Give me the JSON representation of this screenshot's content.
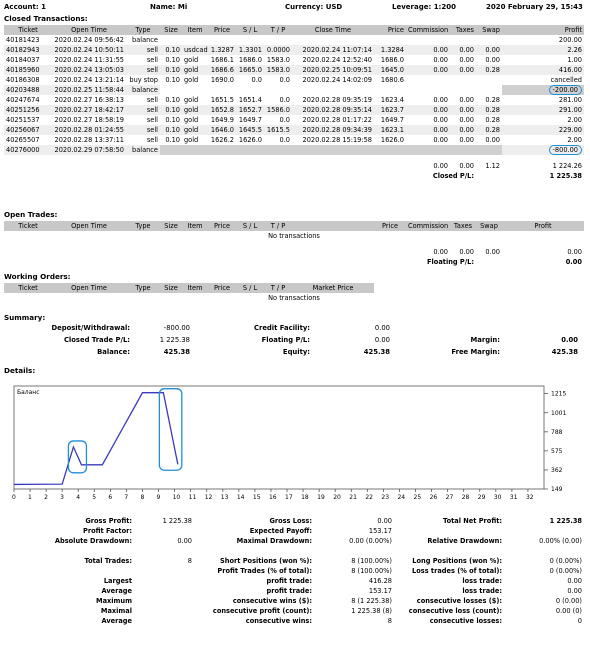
{
  "header": {
    "account": "Account: 1",
    "name": "Name: Mi",
    "currency": "Currency: USD",
    "leverage": "Leverage: 1:200",
    "date": "2020 February 29, 15:43"
  },
  "closed": {
    "title": "Closed Transactions:",
    "columns": [
      "Ticket",
      "Open Time",
      "Type",
      "Size",
      "Item",
      "Price",
      "S / L",
      "T / P",
      "Close Time",
      "Price",
      "Commission",
      "Taxes",
      "Swap",
      "Profit"
    ],
    "rows": [
      [
        "40181423",
        "2020.02.24 09:56:42",
        "balance",
        "",
        "",
        "",
        "",
        "",
        "",
        "",
        "",
        "",
        "",
        "200.00"
      ],
      [
        "40182943",
        "2020.02.24 10:50:11",
        "sell",
        "0.10",
        "usdcad",
        "1.3287",
        "1.3301",
        "0.0000",
        "2020.02.24 11:07:14",
        "1.3284",
        "0.00",
        "0.00",
        "0.00",
        "2.26"
      ],
      [
        "40184037",
        "2020.02.24 11:31:55",
        "sell",
        "0.10",
        "gold",
        "1686.1",
        "1686.0",
        "1583.0",
        "2020.02.24 12:52:40",
        "1686.0",
        "0.00",
        "0.00",
        "0.00",
        "1.00"
      ],
      [
        "40185960",
        "2020.02.24 13:05:03",
        "sell",
        "0.10",
        "gold",
        "1686.6",
        "1665.0",
        "1583.0",
        "2020.02.25 10:09:51",
        "1645.0",
        "0.00",
        "0.00",
        "0.28",
        "416.00"
      ],
      [
        "40186308",
        "2020.02.24 13:21:14",
        "buy stop",
        "0.10",
        "gold",
        "1690.0",
        "0.0",
        "0.0",
        "2020.02.24 14:02:09",
        "1680.6",
        "",
        "",
        "",
        "cancelled"
      ],
      [
        "40203488",
        "2020.02.25 11:58:44",
        "balance",
        "",
        "",
        "",
        "",
        "",
        "",
        "",
        "",
        "",
        "",
        "-200.00"
      ],
      [
        "40247674",
        "2020.02.27 16:38:13",
        "sell",
        "0.10",
        "gold",
        "1651.5",
        "1651.4",
        "0.0",
        "2020.02.28 09:35:19",
        "1623.4",
        "0.00",
        "0.00",
        "0.28",
        "281.00"
      ],
      [
        "40251256",
        "2020.02.27 18:42:17",
        "sell",
        "0.10",
        "gold",
        "1652.8",
        "1652.7",
        "1586.0",
        "2020.02.28 09:35:14",
        "1623.7",
        "0.00",
        "0.00",
        "0.28",
        "291.00"
      ],
      [
        "40251537",
        "2020.02.27 18:58:19",
        "sell",
        "0.10",
        "gold",
        "1649.9",
        "1649.7",
        "0.0",
        "2020.02.28 01:17:22",
        "1649.7",
        "0.00",
        "0.00",
        "0.28",
        "2.00"
      ],
      [
        "40256067",
        "2020.02.28 01:24:55",
        "sell",
        "0.10",
        "gold",
        "1646.0",
        "1645.5",
        "1615.5",
        "2020.02.28 09:34:39",
        "1623.1",
        "0.00",
        "0.00",
        "0.28",
        "229.00"
      ],
      [
        "40265507",
        "2020.02.28 13:37:11",
        "sell",
        "0.10",
        "gold",
        "1626.2",
        "1626.0",
        "0.0",
        "2020.02.28 15:19:58",
        "1626.0",
        "0.00",
        "0.00",
        "0.00",
        "2.00"
      ],
      [
        "40276000",
        "2020.02.29 07:58:50",
        "balance",
        "",
        "",
        "",
        "",
        "",
        "",
        "",
        "",
        "",
        "",
        "-800.00"
      ]
    ],
    "totals": {
      "commission": "0.00",
      "taxes": "0.00",
      "swap": "1.12",
      "profit": "1 224.26"
    },
    "pl_label": "Closed P/L:",
    "pl_value": "1 225.38"
  },
  "open": {
    "title": "Open Trades:",
    "columns": [
      "Ticket",
      "Open Time",
      "Type",
      "Size",
      "Item",
      "Price",
      "S / L",
      "T / P",
      "",
      "Price",
      "Commission",
      "Taxes",
      "Swap",
      "Profit"
    ],
    "empty": "No transactions",
    "totals": {
      "commission": "0.00",
      "taxes": "0.00",
      "swap": "0.00",
      "profit": "0.00"
    },
    "pl_label": "Floating P/L:",
    "pl_value": "0.00"
  },
  "working": {
    "title": "Working Orders:",
    "columns": [
      "Ticket",
      "Open Time",
      "Type",
      "Size",
      "Item",
      "Price",
      "S / L",
      "T / P",
      "Market Price"
    ],
    "empty": "No transactions"
  },
  "summary": {
    "title": "Summary:",
    "deposit_label": "Deposit/Withdrawal:",
    "deposit": "-800.00",
    "credit_label": "Credit Facility:",
    "credit": "0.00",
    "closed_label": "Closed Trade P/L:",
    "closed": "1 225.38",
    "floating_label": "Floating P/L:",
    "floating": "0.00",
    "margin_label": "Margin:",
    "margin": "0.00",
    "balance_label": "Balance:",
    "balance": "425.38",
    "equity_label": "Equity:",
    "equity": "425.38",
    "free_label": "Free Margin:",
    "free": "425.38"
  },
  "details_title": "Details:",
  "chart_data": {
    "type": "line",
    "series": [
      {
        "name": "Баланс",
        "values": [
          [
            0,
            200
          ],
          [
            1.5,
            202.26
          ],
          [
            3,
            203.26
          ],
          [
            3.7,
            619.26
          ],
          [
            4.2,
            419.26
          ],
          [
            5.5,
            419.26
          ],
          [
            8,
            1225.38
          ],
          [
            9.3,
            1225.38
          ],
          [
            10.2,
            425.38
          ]
        ]
      }
    ],
    "xlim": [
      0,
      33
    ],
    "ylim": [
      149,
      1300
    ],
    "yticks": [
      "1215",
      "1001",
      "788",
      "575",
      "362",
      "149"
    ],
    "ytick_values": [
      1215,
      1001,
      788,
      575,
      362,
      149
    ],
    "xticks": [
      "0",
      "1",
      "2",
      "3",
      "4",
      "5",
      "6",
      "7",
      "8",
      "9",
      "10",
      "11",
      "12",
      "13",
      "14",
      "15",
      "16",
      "17",
      "18",
      "19",
      "20",
      "21",
      "22",
      "23",
      "24",
      "25",
      "26",
      "27",
      "28",
      "29",
      "30",
      "31",
      "32"
    ],
    "legend": "Баланс",
    "line_color": "#3a3abf",
    "highlight_color": "#1f8fd6"
  },
  "stats": [
    [
      "Gross Profit:",
      "1 225.38",
      "Gross Loss:",
      "0.00",
      "Total Net Profit:",
      "1 225.38"
    ],
    [
      "Profit Factor:",
      "",
      "Expected Payoff:",
      "153.17",
      "",
      ""
    ],
    [
      "Absolute Drawdown:",
      "0.00",
      "Maximal Drawdown:",
      "0.00 (0.00%)",
      "Relative Drawdown:",
      "0.00% (0.00)"
    ],
    [
      "",
      "",
      "",
      "",
      "",
      ""
    ],
    [
      "Total Trades:",
      "8",
      "Short Positions (won %):",
      "8 (100.00%)",
      "Long Positions (won %):",
      "0 (0.00%)"
    ],
    [
      "",
      "",
      "Profit Trades (% of total):",
      "8 (100.00%)",
      "Loss trades (% of total):",
      "0 (0.00%)"
    ],
    [
      "Largest",
      "",
      "profit trade:",
      "416.28",
      "loss trade:",
      "0.00"
    ],
    [
      "Average",
      "",
      "profit trade:",
      "153.17",
      "loss trade:",
      "0.00"
    ],
    [
      "Maximum",
      "",
      "consecutive wins ($):",
      "8 (1 225.38)",
      "consecutive losses ($):",
      "0 (0.00)"
    ],
    [
      "Maximal",
      "",
      "consecutive profit (count):",
      "1 225.38 (8)",
      "consecutive loss (count):",
      "0.00 (0)"
    ],
    [
      "Average",
      "",
      "consecutive wins:",
      "8",
      "consecutive losses:",
      "0"
    ]
  ]
}
